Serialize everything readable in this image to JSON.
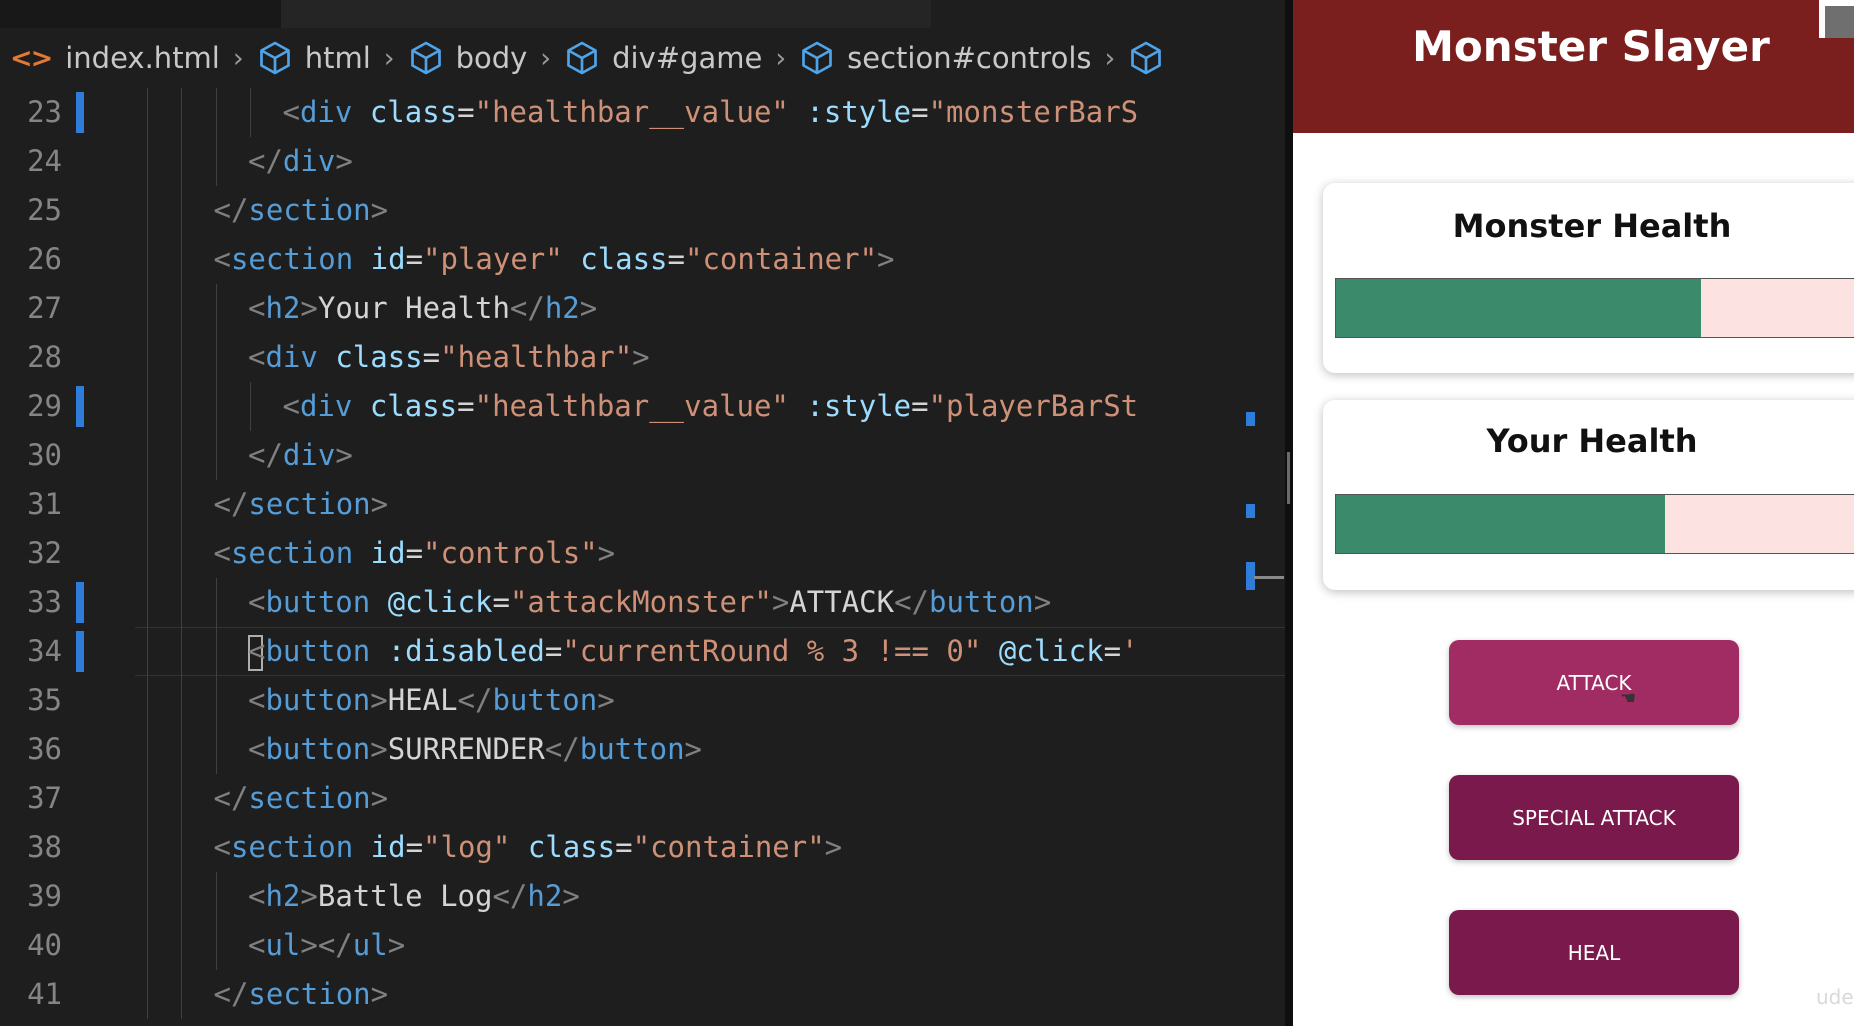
{
  "editor": {
    "breadcrumb": [
      "index.html",
      "html",
      "body",
      "div#game",
      "section#controls",
      ""
    ],
    "lines": [
      {
        "num": "23",
        "modified": true,
        "tokens": [
          [
            "tb",
            "<"
          ],
          [
            "tn",
            "div"
          ],
          [
            "tx",
            " "
          ],
          [
            "an",
            "class"
          ],
          [
            "tx",
            "="
          ],
          [
            "av",
            "\"healthbar__value\""
          ],
          [
            "tx",
            " "
          ],
          [
            "an",
            ":style"
          ],
          [
            "tx",
            "="
          ],
          [
            "av",
            "\"monsterBarS"
          ]
        ]
      },
      {
        "num": "24",
        "modified": false,
        "tokens": [
          [
            "tb",
            "</"
          ],
          [
            "tn",
            "div"
          ],
          [
            "tb",
            ">"
          ]
        ]
      },
      {
        "num": "25",
        "modified": false,
        "tokens": [
          [
            "tb",
            "</"
          ],
          [
            "tn",
            "section"
          ],
          [
            "tb",
            ">"
          ]
        ]
      },
      {
        "num": "26",
        "modified": false,
        "tokens": [
          [
            "tb",
            "<"
          ],
          [
            "tn",
            "section"
          ],
          [
            "tx",
            " "
          ],
          [
            "an",
            "id"
          ],
          [
            "tx",
            "="
          ],
          [
            "av",
            "\"player\""
          ],
          [
            "tx",
            " "
          ],
          [
            "an",
            "class"
          ],
          [
            "tx",
            "="
          ],
          [
            "av",
            "\"container\""
          ],
          [
            "tb",
            ">"
          ]
        ]
      },
      {
        "num": "27",
        "modified": false,
        "tokens": [
          [
            "tb",
            "<"
          ],
          [
            "tn",
            "h2"
          ],
          [
            "tb",
            ">"
          ],
          [
            "tx",
            "Your Health"
          ],
          [
            "tb",
            "</"
          ],
          [
            "tn",
            "h2"
          ],
          [
            "tb",
            ">"
          ]
        ]
      },
      {
        "num": "28",
        "modified": false,
        "tokens": [
          [
            "tb",
            "<"
          ],
          [
            "tn",
            "div"
          ],
          [
            "tx",
            " "
          ],
          [
            "an",
            "class"
          ],
          [
            "tx",
            "="
          ],
          [
            "av",
            "\"healthbar\""
          ],
          [
            "tb",
            ">"
          ]
        ]
      },
      {
        "num": "29",
        "modified": true,
        "tokens": [
          [
            "tb",
            "<"
          ],
          [
            "tn",
            "div"
          ],
          [
            "tx",
            " "
          ],
          [
            "an",
            "class"
          ],
          [
            "tx",
            "="
          ],
          [
            "av",
            "\"healthbar__value\""
          ],
          [
            "tx",
            " "
          ],
          [
            "an",
            ":style"
          ],
          [
            "tx",
            "="
          ],
          [
            "av",
            "\"playerBarSt"
          ]
        ]
      },
      {
        "num": "30",
        "modified": false,
        "tokens": [
          [
            "tb",
            "</"
          ],
          [
            "tn",
            "div"
          ],
          [
            "tb",
            ">"
          ]
        ]
      },
      {
        "num": "31",
        "modified": false,
        "tokens": [
          [
            "tb",
            "</"
          ],
          [
            "tn",
            "section"
          ],
          [
            "tb",
            ">"
          ]
        ]
      },
      {
        "num": "32",
        "modified": false,
        "tokens": [
          [
            "tb",
            "<"
          ],
          [
            "tn",
            "section"
          ],
          [
            "tx",
            " "
          ],
          [
            "an",
            "id"
          ],
          [
            "tx",
            "="
          ],
          [
            "av",
            "\"controls\""
          ],
          [
            "tb",
            ">"
          ]
        ]
      },
      {
        "num": "33",
        "modified": true,
        "tokens": [
          [
            "tb",
            "<"
          ],
          [
            "tn",
            "button"
          ],
          [
            "tx",
            " "
          ],
          [
            "an",
            "@click"
          ],
          [
            "tx",
            "="
          ],
          [
            "av",
            "\"attackMonster\""
          ],
          [
            "tb",
            ">"
          ],
          [
            "tx",
            "ATTACK"
          ],
          [
            "tb",
            "</"
          ],
          [
            "tn",
            "button"
          ],
          [
            "tb",
            ">"
          ]
        ]
      },
      {
        "num": "34",
        "modified": true,
        "cursor": true,
        "tokens": [
          [
            "tb",
            "<"
          ],
          [
            "tn",
            "button"
          ],
          [
            "tx",
            " "
          ],
          [
            "an",
            ":disabled"
          ],
          [
            "tx",
            "="
          ],
          [
            "av",
            "\"currentRound % 3 !== 0\""
          ],
          [
            "tx",
            " "
          ],
          [
            "an",
            "@click"
          ],
          [
            "tx",
            "="
          ],
          [
            "av",
            "'"
          ]
        ]
      },
      {
        "num": "35",
        "modified": false,
        "tokens": [
          [
            "tb",
            "<"
          ],
          [
            "tn",
            "button"
          ],
          [
            "tb",
            ">"
          ],
          [
            "tx",
            "HEAL"
          ],
          [
            "tb",
            "</"
          ],
          [
            "tn",
            "button"
          ],
          [
            "tb",
            ">"
          ]
        ]
      },
      {
        "num": "36",
        "modified": false,
        "tokens": [
          [
            "tb",
            "<"
          ],
          [
            "tn",
            "button"
          ],
          [
            "tb",
            ">"
          ],
          [
            "tx",
            "SURRENDER"
          ],
          [
            "tb",
            "</"
          ],
          [
            "tn",
            "button"
          ],
          [
            "tb",
            ">"
          ]
        ]
      },
      {
        "num": "37",
        "modified": false,
        "tokens": [
          [
            "tb",
            "</"
          ],
          [
            "tn",
            "section"
          ],
          [
            "tb",
            ">"
          ]
        ]
      },
      {
        "num": "38",
        "modified": false,
        "tokens": [
          [
            "tb",
            "<"
          ],
          [
            "tn",
            "section"
          ],
          [
            "tx",
            " "
          ],
          [
            "an",
            "id"
          ],
          [
            "tx",
            "="
          ],
          [
            "av",
            "\"log\""
          ],
          [
            "tx",
            " "
          ],
          [
            "an",
            "class"
          ],
          [
            "tx",
            "="
          ],
          [
            "av",
            "\"container\""
          ],
          [
            "tb",
            ">"
          ]
        ]
      },
      {
        "num": "39",
        "modified": false,
        "tokens": [
          [
            "tb",
            "<"
          ],
          [
            "tn",
            "h2"
          ],
          [
            "tb",
            ">"
          ],
          [
            "tx",
            "Battle Log"
          ],
          [
            "tb",
            "</"
          ],
          [
            "tn",
            "h2"
          ],
          [
            "tb",
            ">"
          ]
        ]
      },
      {
        "num": "40",
        "modified": false,
        "tokens": [
          [
            "tb",
            "<"
          ],
          [
            "tn",
            "ul"
          ],
          [
            "tb",
            "></"
          ],
          [
            "tn",
            "ul"
          ],
          [
            "tb",
            ">"
          ]
        ]
      },
      {
        "num": "41",
        "modified": false,
        "tokens": [
          [
            "tb",
            "</"
          ],
          [
            "tn",
            "section"
          ],
          [
            "tb",
            ">"
          ]
        ]
      }
    ],
    "colors": {
      "tag_bracket": "#808080",
      "tag_name": "#569cd6",
      "attr_name": "#9cdcfe",
      "attr_value": "#ce9178",
      "text": "#d4d4d4",
      "line_number": "#858585",
      "modified_marker": "#2f7ddb"
    }
  },
  "app": {
    "title": "Monster Slayer",
    "monster": {
      "heading": "Monster Health",
      "health_percent": 70
    },
    "player": {
      "heading": "Your Health",
      "health_percent": 63
    },
    "buttons": {
      "attack": "ATTACK",
      "special_attack": "SPECIAL ATTACK",
      "heal": "HEAL"
    },
    "colors": {
      "header": "#7a1e1e",
      "health_fill": "#3a8a6b",
      "health_empty": "#fde2e2",
      "attack_button": "#a12b63",
      "button": "#7a1a4c"
    },
    "watermark": "ude"
  }
}
